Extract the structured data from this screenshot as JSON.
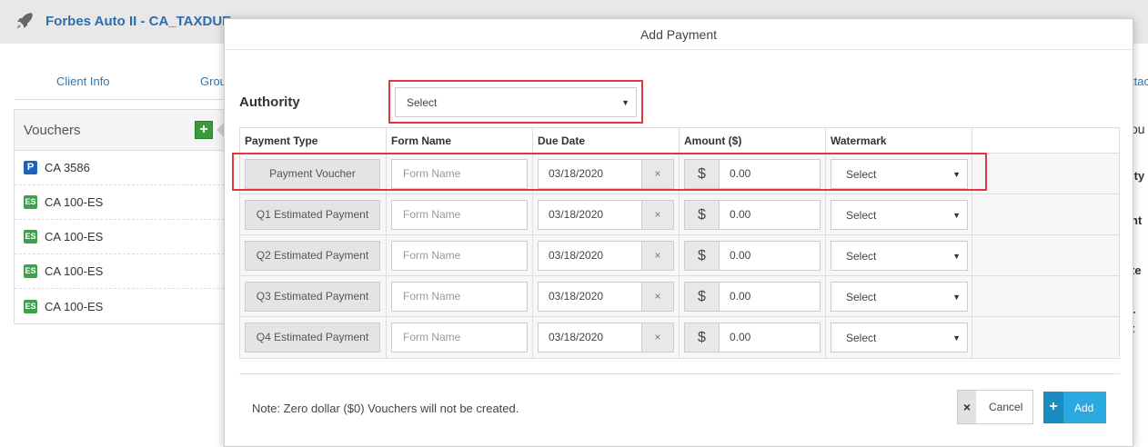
{
  "app": {
    "title": "Forbes Auto II - CA_TAXDUE",
    "tabs": [
      "Client Info",
      "Grou",
      "ttac"
    ]
  },
  "sidebar": {
    "title": "Vouchers",
    "add_icon": "plus-icon",
    "items": [
      {
        "badge": "P",
        "label": "CA 3586"
      },
      {
        "badge": "ES",
        "label": "CA 100-ES"
      },
      {
        "badge": "ES",
        "label": "CA 100-ES"
      },
      {
        "badge": "ES",
        "label": "CA 100-ES"
      },
      {
        "badge": "ES",
        "label": "CA 100-ES"
      }
    ]
  },
  "right_fragments": [
    "ou",
    "ity",
    "nt",
    "te",
    "r",
    "t"
  ],
  "modal": {
    "title": "Add Payment",
    "authority_label": "Authority",
    "authority_value": "Select",
    "columns": [
      "Payment Type",
      "Form Name",
      "Due Date",
      "Amount ($)",
      "Watermark"
    ],
    "rows": [
      {
        "type": "Payment Voucher",
        "form_placeholder": "Form Name",
        "due_date": "03/18/2020",
        "clear": "×",
        "currency": "$",
        "amount": "0.00",
        "watermark": "Select"
      },
      {
        "type": "Q1 Estimated Payment",
        "form_placeholder": "Form Name",
        "due_date": "03/18/2020",
        "clear": "×",
        "currency": "$",
        "amount": "0.00",
        "watermark": "Select"
      },
      {
        "type": "Q2 Estimated Payment",
        "form_placeholder": "Form Name",
        "due_date": "03/18/2020",
        "clear": "×",
        "currency": "$",
        "amount": "0.00",
        "watermark": "Select"
      },
      {
        "type": "Q3 Estimated Payment",
        "form_placeholder": "Form Name",
        "due_date": "03/18/2020",
        "clear": "×",
        "currency": "$",
        "amount": "0.00",
        "watermark": "Select"
      },
      {
        "type": "Q4 Estimated Payment",
        "form_placeholder": "Form Name",
        "due_date": "03/18/2020",
        "clear": "×",
        "currency": "$",
        "amount": "0.00",
        "watermark": "Select"
      }
    ],
    "note": "Note: Zero dollar ($0) Vouchers will not be created.",
    "cancel_label": "Cancel",
    "add_label": "Add"
  },
  "colors": {
    "highlight": "#e0383e",
    "add_button": "#2aa8e0",
    "link": "#2a7ab8"
  }
}
